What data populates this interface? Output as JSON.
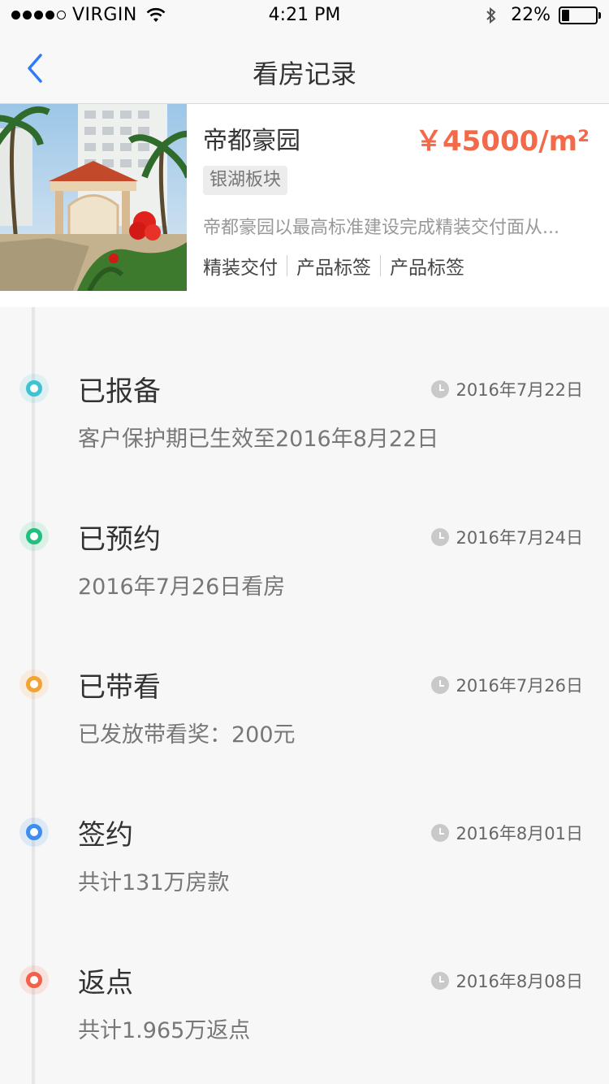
{
  "status_bar": {
    "carrier": "VIRGIN",
    "time": "4:21 PM",
    "battery": "22%",
    "battery_level": 0.22
  },
  "nav": {
    "title": "看房记录",
    "back_icon": "chevron-left-icon",
    "accent": "#2f7cf6"
  },
  "property": {
    "name": "帝都豪园",
    "price": "￥45000/m²",
    "price_color": "#f26a4a",
    "area_tag": "银湖板块",
    "description": "帝都豪园以最高标准建设完成精装交付面从...",
    "labels": [
      "精装交付",
      "产品标签",
      "产品标签"
    ]
  },
  "events": [
    {
      "title": "已报备",
      "date": "2016年7月22日",
      "desc": "客户保护期已生效至2016年8月22日",
      "color": "#3fc3d2"
    },
    {
      "title": "已预约",
      "date": "2016年7月24日",
      "desc": "2016年7月26日看房",
      "color": "#22c07e"
    },
    {
      "title": "已带看",
      "date": "2016年7月26日",
      "desc": "已发放带看奖：200元",
      "color": "#f5a235"
    },
    {
      "title": "签约",
      "date": "2016年8月01日",
      "desc": "共计131万房款",
      "color": "#3d8ef0"
    },
    {
      "title": "返点",
      "date": "2016年8月08日",
      "desc": "共计1.965万返点",
      "color": "#f2614a"
    }
  ]
}
